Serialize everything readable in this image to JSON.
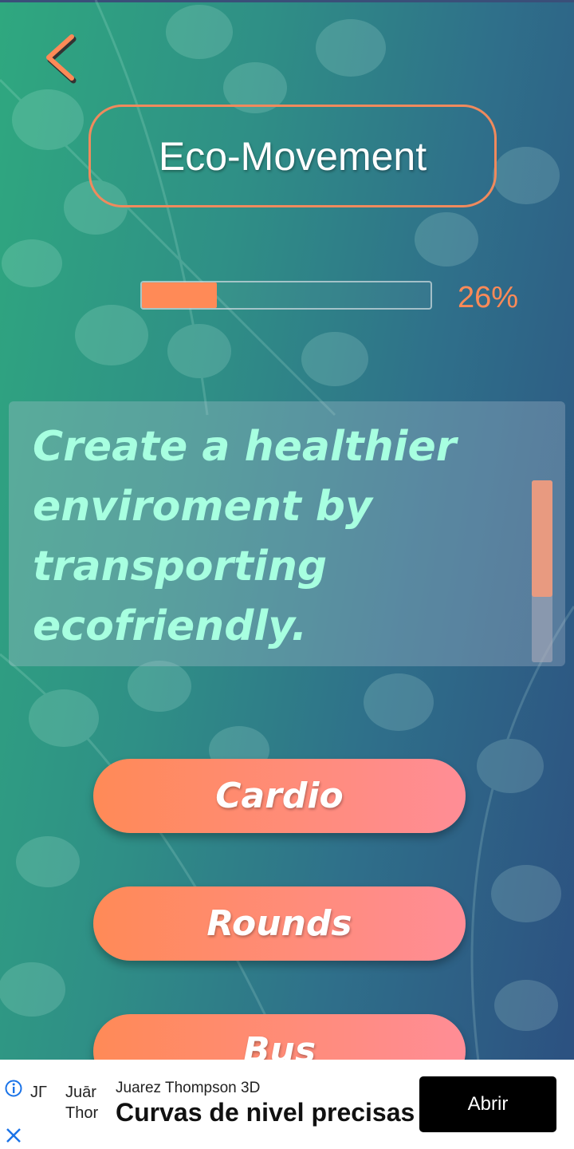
{
  "header": {
    "title": "Eco-Movement",
    "back_icon": "chevron-left-icon"
  },
  "progress": {
    "value": 0.26,
    "label": "26%"
  },
  "description": {
    "text": "Create a healthier enviroment by transporting ecofriendly."
  },
  "options": [
    {
      "label": "Cardio"
    },
    {
      "label": "Rounds"
    },
    {
      "label": "Bus"
    }
  ],
  "ad": {
    "logo_line_1": "JΓ",
    "logo_line_2": "Juār",
    "logo_line_3": "Thor",
    "advertiser": "Juarez Thompson 3D",
    "headline": "Curvas de nivel precisas",
    "cta": "Abrir",
    "info_icon": "info-icon",
    "close_icon": "close-icon"
  },
  "colors": {
    "accent": "#ff8a57",
    "button_gradient_end": "#ff8d96",
    "description_text": "#a7ffe0",
    "background_start": "#2fa87f",
    "background_end": "#2c4f80"
  }
}
